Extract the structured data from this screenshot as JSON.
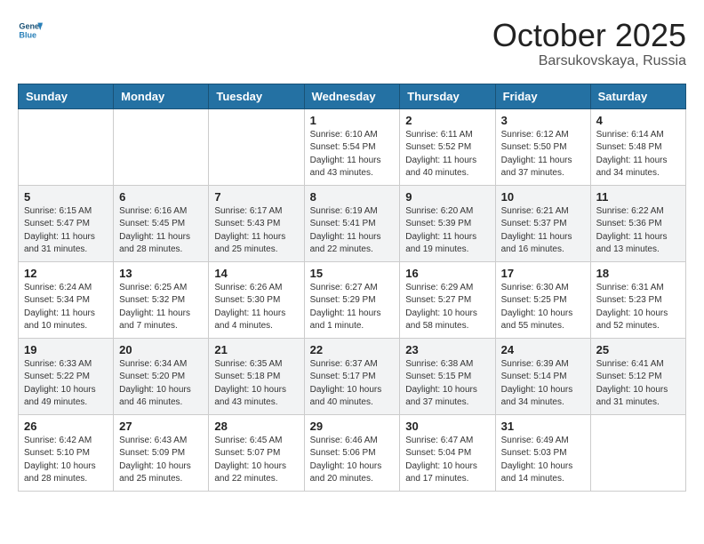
{
  "header": {
    "logo_line1": "General",
    "logo_line2": "Blue",
    "month": "October 2025",
    "location": "Barsukovskaya, Russia"
  },
  "weekdays": [
    "Sunday",
    "Monday",
    "Tuesday",
    "Wednesday",
    "Thursday",
    "Friday",
    "Saturday"
  ],
  "rows": [
    {
      "alt": false,
      "cells": [
        {
          "day": "",
          "info": ""
        },
        {
          "day": "",
          "info": ""
        },
        {
          "day": "",
          "info": ""
        },
        {
          "day": "1",
          "info": "Sunrise: 6:10 AM\nSunset: 5:54 PM\nDaylight: 11 hours\nand 43 minutes."
        },
        {
          "day": "2",
          "info": "Sunrise: 6:11 AM\nSunset: 5:52 PM\nDaylight: 11 hours\nand 40 minutes."
        },
        {
          "day": "3",
          "info": "Sunrise: 6:12 AM\nSunset: 5:50 PM\nDaylight: 11 hours\nand 37 minutes."
        },
        {
          "day": "4",
          "info": "Sunrise: 6:14 AM\nSunset: 5:48 PM\nDaylight: 11 hours\nand 34 minutes."
        }
      ]
    },
    {
      "alt": true,
      "cells": [
        {
          "day": "5",
          "info": "Sunrise: 6:15 AM\nSunset: 5:47 PM\nDaylight: 11 hours\nand 31 minutes."
        },
        {
          "day": "6",
          "info": "Sunrise: 6:16 AM\nSunset: 5:45 PM\nDaylight: 11 hours\nand 28 minutes."
        },
        {
          "day": "7",
          "info": "Sunrise: 6:17 AM\nSunset: 5:43 PM\nDaylight: 11 hours\nand 25 minutes."
        },
        {
          "day": "8",
          "info": "Sunrise: 6:19 AM\nSunset: 5:41 PM\nDaylight: 11 hours\nand 22 minutes."
        },
        {
          "day": "9",
          "info": "Sunrise: 6:20 AM\nSunset: 5:39 PM\nDaylight: 11 hours\nand 19 minutes."
        },
        {
          "day": "10",
          "info": "Sunrise: 6:21 AM\nSunset: 5:37 PM\nDaylight: 11 hours\nand 16 minutes."
        },
        {
          "day": "11",
          "info": "Sunrise: 6:22 AM\nSunset: 5:36 PM\nDaylight: 11 hours\nand 13 minutes."
        }
      ]
    },
    {
      "alt": false,
      "cells": [
        {
          "day": "12",
          "info": "Sunrise: 6:24 AM\nSunset: 5:34 PM\nDaylight: 11 hours\nand 10 minutes."
        },
        {
          "day": "13",
          "info": "Sunrise: 6:25 AM\nSunset: 5:32 PM\nDaylight: 11 hours\nand 7 minutes."
        },
        {
          "day": "14",
          "info": "Sunrise: 6:26 AM\nSunset: 5:30 PM\nDaylight: 11 hours\nand 4 minutes."
        },
        {
          "day": "15",
          "info": "Sunrise: 6:27 AM\nSunset: 5:29 PM\nDaylight: 11 hours\nand 1 minute."
        },
        {
          "day": "16",
          "info": "Sunrise: 6:29 AM\nSunset: 5:27 PM\nDaylight: 10 hours\nand 58 minutes."
        },
        {
          "day": "17",
          "info": "Sunrise: 6:30 AM\nSunset: 5:25 PM\nDaylight: 10 hours\nand 55 minutes."
        },
        {
          "day": "18",
          "info": "Sunrise: 6:31 AM\nSunset: 5:23 PM\nDaylight: 10 hours\nand 52 minutes."
        }
      ]
    },
    {
      "alt": true,
      "cells": [
        {
          "day": "19",
          "info": "Sunrise: 6:33 AM\nSunset: 5:22 PM\nDaylight: 10 hours\nand 49 minutes."
        },
        {
          "day": "20",
          "info": "Sunrise: 6:34 AM\nSunset: 5:20 PM\nDaylight: 10 hours\nand 46 minutes."
        },
        {
          "day": "21",
          "info": "Sunrise: 6:35 AM\nSunset: 5:18 PM\nDaylight: 10 hours\nand 43 minutes."
        },
        {
          "day": "22",
          "info": "Sunrise: 6:37 AM\nSunset: 5:17 PM\nDaylight: 10 hours\nand 40 minutes."
        },
        {
          "day": "23",
          "info": "Sunrise: 6:38 AM\nSunset: 5:15 PM\nDaylight: 10 hours\nand 37 minutes."
        },
        {
          "day": "24",
          "info": "Sunrise: 6:39 AM\nSunset: 5:14 PM\nDaylight: 10 hours\nand 34 minutes."
        },
        {
          "day": "25",
          "info": "Sunrise: 6:41 AM\nSunset: 5:12 PM\nDaylight: 10 hours\nand 31 minutes."
        }
      ]
    },
    {
      "alt": false,
      "cells": [
        {
          "day": "26",
          "info": "Sunrise: 6:42 AM\nSunset: 5:10 PM\nDaylight: 10 hours\nand 28 minutes."
        },
        {
          "day": "27",
          "info": "Sunrise: 6:43 AM\nSunset: 5:09 PM\nDaylight: 10 hours\nand 25 minutes."
        },
        {
          "day": "28",
          "info": "Sunrise: 6:45 AM\nSunset: 5:07 PM\nDaylight: 10 hours\nand 22 minutes."
        },
        {
          "day": "29",
          "info": "Sunrise: 6:46 AM\nSunset: 5:06 PM\nDaylight: 10 hours\nand 20 minutes."
        },
        {
          "day": "30",
          "info": "Sunrise: 6:47 AM\nSunset: 5:04 PM\nDaylight: 10 hours\nand 17 minutes."
        },
        {
          "day": "31",
          "info": "Sunrise: 6:49 AM\nSunset: 5:03 PM\nDaylight: 10 hours\nand 14 minutes."
        },
        {
          "day": "",
          "info": ""
        }
      ]
    }
  ]
}
